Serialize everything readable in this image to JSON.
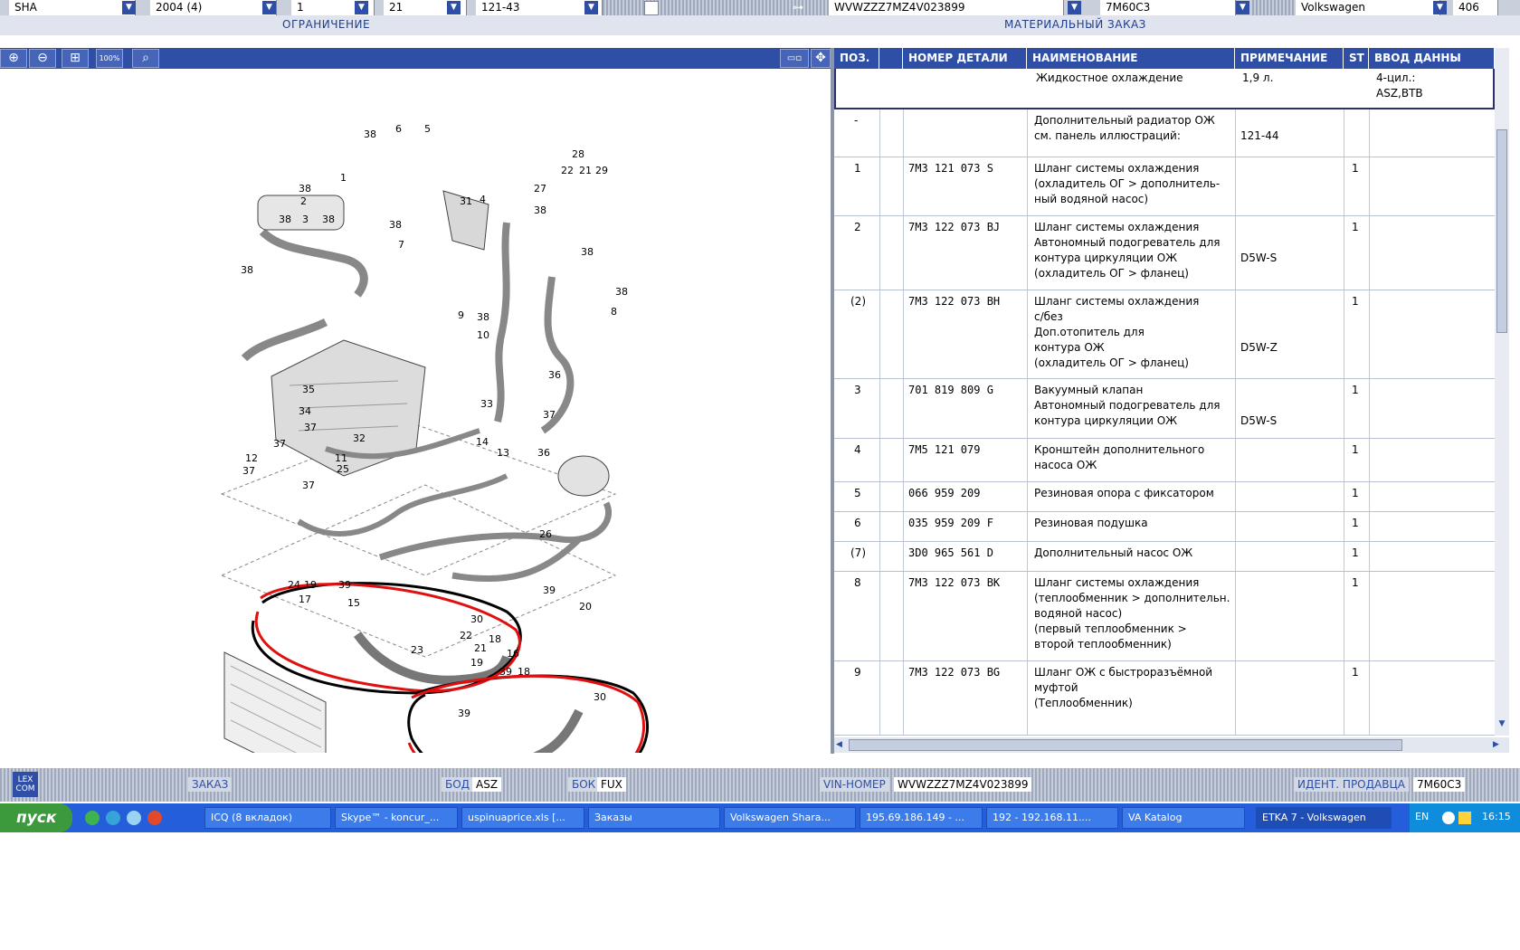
{
  "top_selectors": [
    {
      "value": "SHA"
    },
    {
      "value": "2004 (4)"
    },
    {
      "value": "1"
    },
    {
      "value": "21"
    },
    {
      "value": "121-43"
    },
    {
      "value": "WVWZZZ7MZ4V023899"
    },
    {
      "value": "7M60C3"
    },
    {
      "value": "Volkswagen"
    },
    {
      "value": "406"
    }
  ],
  "header": {
    "left_label": "ОГРАНИЧЕНИЕ",
    "right_label": "МАТЕРИАЛЬНЫЙ ЗАКАЗ"
  },
  "toolbar": {
    "zoom100_label": "100%"
  },
  "table": {
    "columns": [
      "ПОЗ.",
      "",
      "НОМЕР ДЕТАЛИ",
      "НАИМЕНОВАНИЕ",
      "ПРИМЕЧАНИЕ",
      "ST",
      "ВВОД ДАННЫ"
    ],
    "header_row": {
      "name": "Жидкостное охлаждение",
      "note": "1,9 л.",
      "input": "4-цил.:\nASZ,BTB"
    },
    "rows": [
      {
        "pos": "-",
        "part": "",
        "name": "Дополнительный радиатор ОЖ\n см. панель иллюстраций:",
        "note": "\n121-44",
        "st": ""
      },
      {
        "pos": "1",
        "part": "7M3 121 073 S",
        "name": "Шланг системы охлаждения\n(охладитель ОГ > дополнитель-\n ный водяной насос)",
        "note": "",
        "st": "1"
      },
      {
        "pos": "2",
        "part": "7M3 122 073 BJ",
        "name": "Шланг системы охлаждения\nАвтономный подогреватель для\nконтура циркуляции ОЖ\n(охладитель ОГ > фланец)",
        "note": "\n\nD5W-S",
        "st": "1"
      },
      {
        "pos": "(2)",
        "part": "7M3 122 073 BH",
        "name": "Шланг системы охлаждения\nс/без\nДоп.отопитель для\nконтура ОЖ\n(охладитель ОГ > фланец)",
        "note": "\n\n\nD5W-Z",
        "st": "1"
      },
      {
        "pos": "3",
        "part": "701 819 809 G",
        "name": "Вакуумный клапан\nАвтономный подогреватель для\nконтура циркуляции ОЖ",
        "note": "\n\nD5W-S",
        "st": "1"
      },
      {
        "pos": "4",
        "part": "7M5 121 079",
        "name": "Кронштейн дополнительного\nнасоса ОЖ",
        "note": "",
        "st": "1"
      },
      {
        "pos": "5",
        "part": "066 959 209",
        "name": "Резиновая опора с фиксатором",
        "note": "",
        "st": "1"
      },
      {
        "pos": "6",
        "part": "035 959 209 F",
        "name": "Резиновая подушка",
        "note": "",
        "st": "1"
      },
      {
        "pos": "(7)",
        "part": "3D0 965 561 D",
        "name": "Дополнительный насос ОЖ",
        "note": "",
        "st": "1"
      },
      {
        "pos": "8",
        "part": "7M3 122 073 BK",
        "name": "Шланг системы охлаждения\n(теплообменник > дополнительн.\n водяной насос)\n(первый теплообменник >\n второй теплообменник)",
        "note": "",
        "st": "1"
      },
      {
        "pos": "9",
        "part": "7M3 122 073 BG",
        "name": "Шланг ОЖ с быстроразъёмной\nмуфтой\n(Теплообменник)",
        "note": "",
        "st": "1"
      }
    ]
  },
  "diagram_labels": [
    "38",
    "6",
    "5",
    "1",
    "38",
    "31",
    "4",
    "27",
    "38",
    "28",
    "22",
    "21",
    "29",
    "2",
    "38",
    "3",
    "38",
    "38",
    "7",
    "38",
    "38",
    "38",
    "8",
    "9",
    "38",
    "10",
    "36",
    "35",
    "34",
    "33",
    "37",
    "32",
    "14",
    "13",
    "37",
    "36",
    "37",
    "12",
    "11",
    "25",
    "37",
    "37",
    "26",
    "24",
    "19",
    "39",
    "17",
    "15",
    "39",
    "23",
    "22",
    "21",
    "18",
    "16",
    "20",
    "19",
    "39",
    "18",
    "30",
    "39",
    "30"
  ],
  "status_bar": {
    "logo": "LEX\nCOM",
    "order_label": "ЗАКАЗ",
    "bod_label": "БОД",
    "bod_value": "ASZ",
    "bok_label": "БОК",
    "bok_value": "FUX",
    "vin_label": "VIN-НОМЕР",
    "vin_value": "WVWZZZ7MZ4V023899",
    "dealer_label": "ИДЕНТ. ПРОДАВЦА",
    "dealer_value": "7M60C3"
  },
  "taskbar": {
    "start_label": "пуск",
    "tasks": [
      {
        "label": "ICQ (8 вкладок)"
      },
      {
        "label": "Skype™ - koncur_..."
      },
      {
        "label": "uspinuaprice.xls [..."
      },
      {
        "label": "Заказы"
      },
      {
        "label": "Volkswagen Shara..."
      },
      {
        "label": "195.69.186.149 - ..."
      },
      {
        "label": "192 - 192.168.11...."
      },
      {
        "label": "VA Katalog"
      },
      {
        "label": "ETKA 7 - Volkswagen"
      }
    ],
    "lang": "EN",
    "clock": "16:15"
  },
  "colors": {
    "accent": "#2f4fa6",
    "circle_red": "#e01010",
    "circle_black": "#000000"
  }
}
